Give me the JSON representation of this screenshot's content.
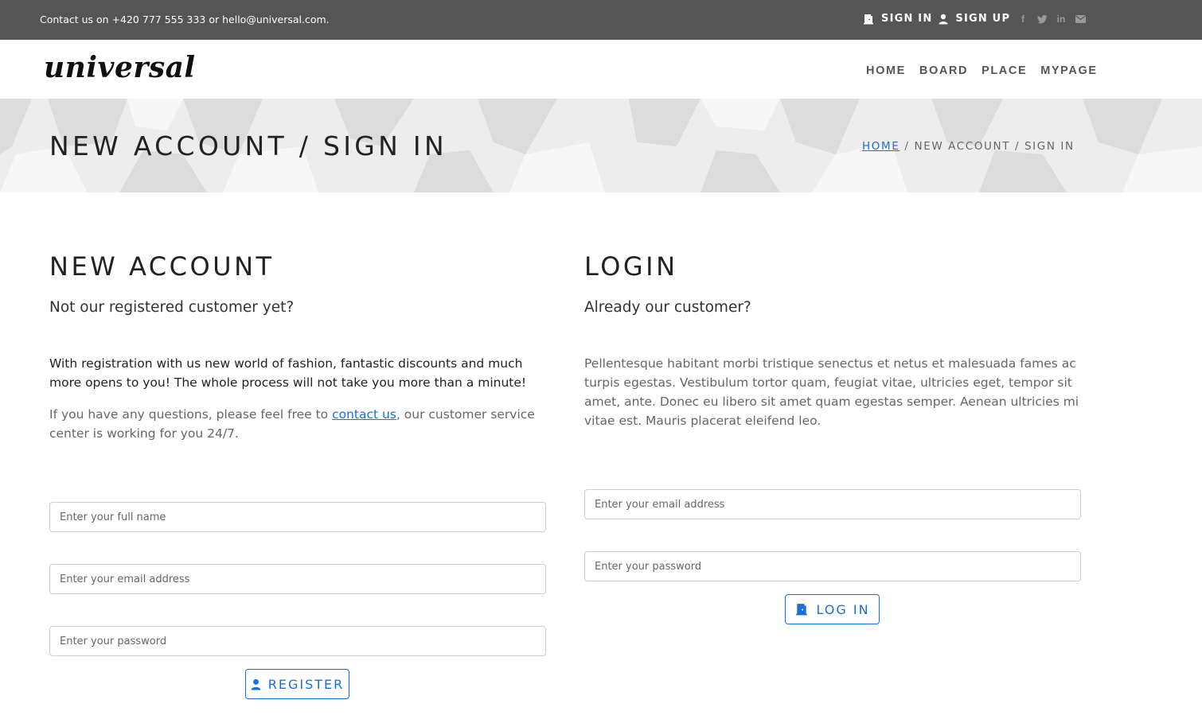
{
  "topbar": {
    "contact": "Contact us on +420 777 555 333 or hello@universal.com.",
    "sign_in": "SIGN IN",
    "sign_up": "SIGN UP",
    "social_icons": [
      "facebook-icon",
      "twitter-icon",
      "linkedin-icon",
      "email-icon"
    ]
  },
  "nav": {
    "logo": "universal",
    "items": [
      "HOME",
      "BOARD",
      "PLACE",
      "MYPAGE"
    ]
  },
  "banner": {
    "title": "NEW ACCOUNT / SIGN IN",
    "breadcrumb_home": "HOME",
    "breadcrumb_current": "NEW ACCOUNT / SIGN IN"
  },
  "register": {
    "heading": "NEW ACCOUNT",
    "lead": "Not our registered customer yet?",
    "text": "With registration with us new world of fashion, fantastic discounts and much more opens to you! The whole process will not take you more than a minute!",
    "help_before": "If you have any questions, please feel free to ",
    "help_link": "contact us",
    "help_after": ", our customer service center is working for you 24/7.",
    "name_placeholder": "Enter your full name",
    "email_placeholder": "Enter your email address",
    "password_placeholder": "Enter your password",
    "button": "REGISTER"
  },
  "login": {
    "heading": "LOGIN",
    "lead": "Already our customer?",
    "text": "Pellentesque habitant morbi tristique senectus et netus et malesuada fames ac turpis egestas. Vestibulum tortor quam, feugiat vitae, ultricies eget, tempor sit amet, ante. Donec eu libero sit amet quam egestas semper. Aenean ultricies mi vitae est. Mauris placerat eleifend leo.",
    "email_placeholder": "Enter your email address",
    "password_placeholder": "Enter your password",
    "button": "LOG IN"
  },
  "colors": {
    "topbar": "#555555",
    "accent": "#1a6ed8",
    "banner": "#efefef"
  }
}
